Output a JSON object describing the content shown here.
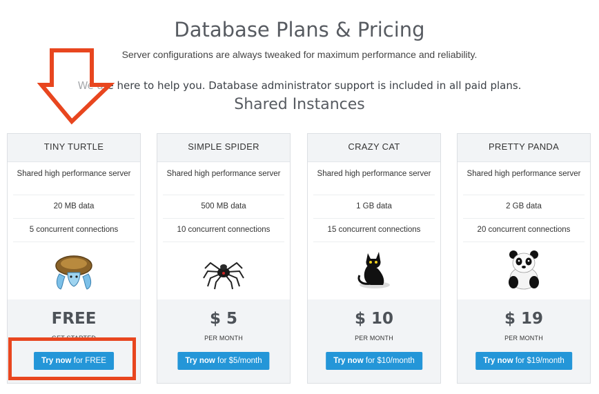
{
  "header": {
    "title": "Database Plans & Pricing",
    "subtitle": "Server configurations are always tweaked for maximum performance and reliability.",
    "support_text": "We are here to help you. Database administrator support is included in all paid plans.",
    "section_title": "Shared Instances"
  },
  "plans": [
    {
      "name": "TINY TURTLE",
      "server": "Shared high performance server",
      "data": "20 MB data",
      "connections": "5 concurrent connections",
      "icon": "turtle-icon",
      "price": "FREE",
      "period": "GET STARTED",
      "button_strong": "Try now",
      "button_rest": " for FREE"
    },
    {
      "name": "SIMPLE SPIDER",
      "server": "Shared high performance server",
      "data": "500 MB data",
      "connections": "10 concurrent connections",
      "icon": "spider-icon",
      "price": "$ 5",
      "period": "PER MONTH",
      "button_strong": "Try now",
      "button_rest": " for $5/month"
    },
    {
      "name": "CRAZY CAT",
      "server": "Shared high performance server",
      "data": "1 GB data",
      "connections": "15 concurrent connections",
      "icon": "cat-icon",
      "price": "$ 10",
      "period": "PER MONTH",
      "button_strong": "Try now",
      "button_rest": " for $10/month"
    },
    {
      "name": "PRETTY PANDA",
      "server": "Shared high performance server",
      "data": "2 GB data",
      "connections": "20 concurrent connections",
      "icon": "panda-icon",
      "price": "$ 19",
      "period": "PER MONTH",
      "button_strong": "Try now",
      "button_rest": " for $19/month"
    }
  ],
  "annotations": {
    "highlight_color": "#e8461f",
    "icons": [
      "down-arrow-icon"
    ]
  },
  "colors": {
    "button": "#2496d8",
    "card_header": "#f2f4f6",
    "heading": "#575b61"
  }
}
